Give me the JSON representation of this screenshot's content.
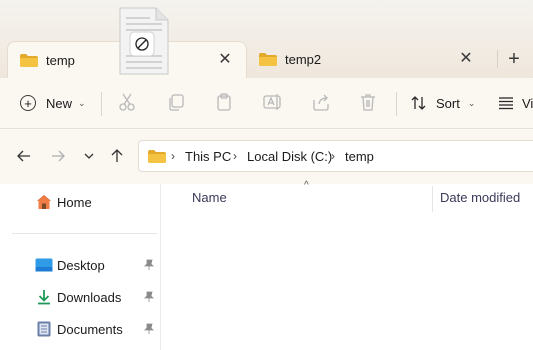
{
  "tabs": [
    {
      "label": "temp",
      "active": true,
      "close": "✕"
    },
    {
      "label": "temp2",
      "active": false,
      "close": "✕"
    }
  ],
  "new_tab_symbol": "+",
  "toolbar": {
    "new_label": "New",
    "sort_label": "Sort",
    "view_label": "Vi",
    "icons": [
      "cut-icon",
      "copy-icon",
      "paste-icon",
      "rename-icon",
      "share-icon",
      "delete-icon"
    ]
  },
  "breadcrumb": [
    "This PC",
    "Local Disk (C:)",
    "temp"
  ],
  "sidebar": {
    "items": [
      {
        "label": "Home",
        "icon": "home-icon",
        "pinned": false
      },
      {
        "label": "Desktop",
        "icon": "desktop-icon",
        "pinned": true
      },
      {
        "label": "Downloads",
        "icon": "downloads-icon",
        "pinned": true
      },
      {
        "label": "Documents",
        "icon": "documents-icon",
        "pinned": true
      }
    ]
  },
  "columns": [
    "Name",
    "Date modified"
  ],
  "colors": {
    "folder": "#f5c342",
    "folder_dark": "#e2a92a",
    "accent_blue": "#1e7cd6",
    "download_green": "#1f9a5a"
  }
}
